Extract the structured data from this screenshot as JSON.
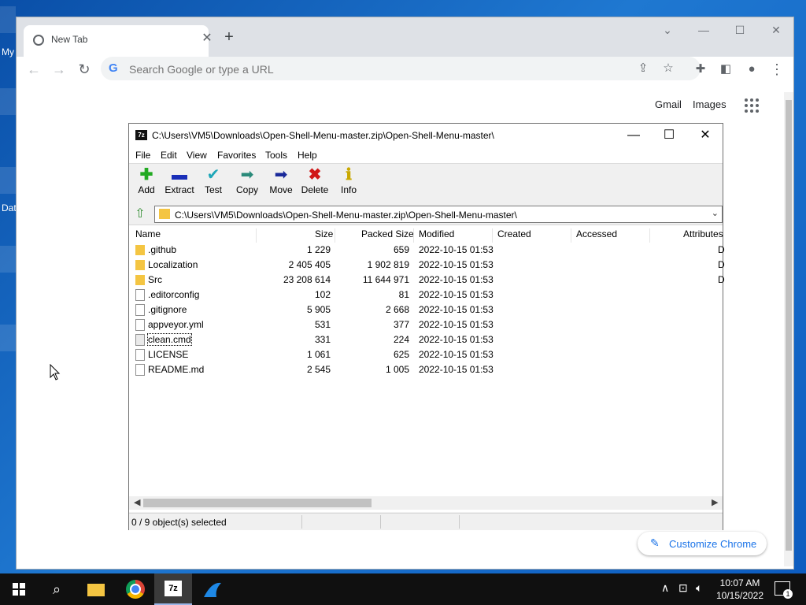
{
  "desktop": {
    "labels": [
      "My",
      "Dat"
    ]
  },
  "chrome": {
    "tab_title": "New Tab",
    "omnibox_placeholder": "Search Google or type a URL",
    "gmail": "Gmail",
    "images": "Images",
    "customize": "Customize Chrome"
  },
  "zip": {
    "title": "C:\\Users\\VM5\\Downloads\\Open-Shell-Menu-master.zip\\Open-Shell-Menu-master\\",
    "menu": [
      "File",
      "Edit",
      "View",
      "Favorites",
      "Tools",
      "Help"
    ],
    "tools": [
      {
        "label": "Add",
        "icon": "plus-icon",
        "color": "#22aa22"
      },
      {
        "label": "Extract",
        "icon": "minus-icon",
        "color": "#1a2fb8"
      },
      {
        "label": "Test",
        "icon": "check-icon",
        "color": "#1fa7b8"
      },
      {
        "label": "Copy",
        "icon": "copy-arrow-icon",
        "color": "#2a8a7a"
      },
      {
        "label": "Move",
        "icon": "move-arrow-icon",
        "color": "#1a2a9a"
      },
      {
        "label": "Delete",
        "icon": "delete-x-icon",
        "color": "#d01818"
      },
      {
        "label": "Info",
        "icon": "info-icon",
        "color": "#c9a800"
      }
    ],
    "path": "C:\\Users\\VM5\\Downloads\\Open-Shell-Menu-master.zip\\Open-Shell-Menu-master\\",
    "columns": [
      "Name",
      "Size",
      "Packed Size",
      "Modified",
      "Created",
      "Accessed",
      "Attributes"
    ],
    "rows": [
      {
        "name": ".github",
        "size": "1 229",
        "packed": "659",
        "modified": "2022-10-15 01:53",
        "type": "folder",
        "attr": "D"
      },
      {
        "name": "Localization",
        "size": "2 405 405",
        "packed": "1 902 819",
        "modified": "2022-10-15 01:53",
        "type": "folder",
        "attr": "D"
      },
      {
        "name": "Src",
        "size": "23 208 614",
        "packed": "11 644 971",
        "modified": "2022-10-15 01:53",
        "type": "folder",
        "attr": "D"
      },
      {
        "name": ".editorconfig",
        "size": "102",
        "packed": "81",
        "modified": "2022-10-15 01:53",
        "type": "file",
        "attr": ""
      },
      {
        "name": ".gitignore",
        "size": "5 905",
        "packed": "2 668",
        "modified": "2022-10-15 01:53",
        "type": "file",
        "attr": ""
      },
      {
        "name": "appveyor.yml",
        "size": "531",
        "packed": "377",
        "modified": "2022-10-15 01:53",
        "type": "file",
        "attr": ""
      },
      {
        "name": "clean.cmd",
        "size": "331",
        "packed": "224",
        "modified": "2022-10-15 01:53",
        "type": "cmd",
        "attr": ""
      },
      {
        "name": "LICENSE",
        "size": "1 061",
        "packed": "625",
        "modified": "2022-10-15 01:53",
        "type": "file",
        "attr": ""
      },
      {
        "name": "README.md",
        "size": "2 545",
        "packed": "1 005",
        "modified": "2022-10-15 01:53",
        "type": "file",
        "attr": ""
      }
    ],
    "status": "0 / 9 object(s) selected"
  },
  "taskbar": {
    "time": "10:07 AM",
    "date": "10/15/2022",
    "notifications": "1",
    "sevenzip_label": "7z"
  },
  "colors": {
    "desktop": "#1565c0",
    "folder": "#f4c542",
    "accent": "#1a73e8"
  }
}
